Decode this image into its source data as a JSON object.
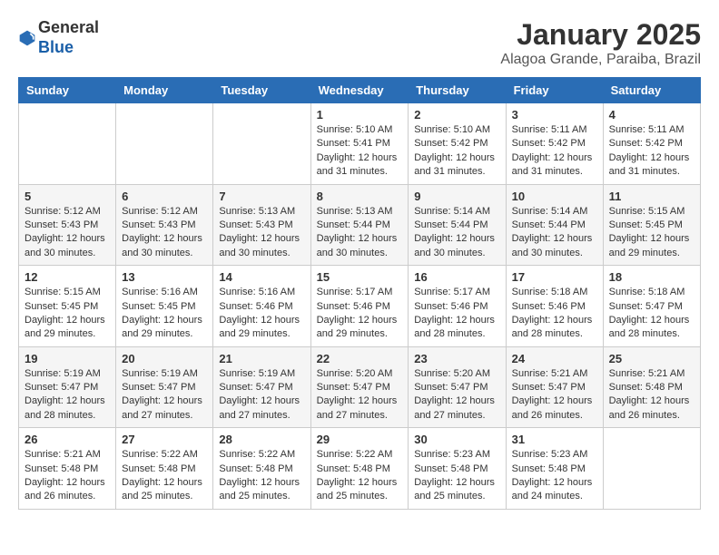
{
  "header": {
    "logo_line1": "General",
    "logo_line2": "Blue",
    "month_title": "January 2025",
    "location": "Alagoa Grande, Paraiba, Brazil"
  },
  "weekdays": [
    "Sunday",
    "Monday",
    "Tuesday",
    "Wednesday",
    "Thursday",
    "Friday",
    "Saturday"
  ],
  "weeks": [
    [
      {
        "day": "",
        "info": ""
      },
      {
        "day": "",
        "info": ""
      },
      {
        "day": "",
        "info": ""
      },
      {
        "day": "1",
        "info": "Sunrise: 5:10 AM\nSunset: 5:41 PM\nDaylight: 12 hours\nand 31 minutes."
      },
      {
        "day": "2",
        "info": "Sunrise: 5:10 AM\nSunset: 5:42 PM\nDaylight: 12 hours\nand 31 minutes."
      },
      {
        "day": "3",
        "info": "Sunrise: 5:11 AM\nSunset: 5:42 PM\nDaylight: 12 hours\nand 31 minutes."
      },
      {
        "day": "4",
        "info": "Sunrise: 5:11 AM\nSunset: 5:42 PM\nDaylight: 12 hours\nand 31 minutes."
      }
    ],
    [
      {
        "day": "5",
        "info": "Sunrise: 5:12 AM\nSunset: 5:43 PM\nDaylight: 12 hours\nand 30 minutes."
      },
      {
        "day": "6",
        "info": "Sunrise: 5:12 AM\nSunset: 5:43 PM\nDaylight: 12 hours\nand 30 minutes."
      },
      {
        "day": "7",
        "info": "Sunrise: 5:13 AM\nSunset: 5:43 PM\nDaylight: 12 hours\nand 30 minutes."
      },
      {
        "day": "8",
        "info": "Sunrise: 5:13 AM\nSunset: 5:44 PM\nDaylight: 12 hours\nand 30 minutes."
      },
      {
        "day": "9",
        "info": "Sunrise: 5:14 AM\nSunset: 5:44 PM\nDaylight: 12 hours\nand 30 minutes."
      },
      {
        "day": "10",
        "info": "Sunrise: 5:14 AM\nSunset: 5:44 PM\nDaylight: 12 hours\nand 30 minutes."
      },
      {
        "day": "11",
        "info": "Sunrise: 5:15 AM\nSunset: 5:45 PM\nDaylight: 12 hours\nand 29 minutes."
      }
    ],
    [
      {
        "day": "12",
        "info": "Sunrise: 5:15 AM\nSunset: 5:45 PM\nDaylight: 12 hours\nand 29 minutes."
      },
      {
        "day": "13",
        "info": "Sunrise: 5:16 AM\nSunset: 5:45 PM\nDaylight: 12 hours\nand 29 minutes."
      },
      {
        "day": "14",
        "info": "Sunrise: 5:16 AM\nSunset: 5:46 PM\nDaylight: 12 hours\nand 29 minutes."
      },
      {
        "day": "15",
        "info": "Sunrise: 5:17 AM\nSunset: 5:46 PM\nDaylight: 12 hours\nand 29 minutes."
      },
      {
        "day": "16",
        "info": "Sunrise: 5:17 AM\nSunset: 5:46 PM\nDaylight: 12 hours\nand 28 minutes."
      },
      {
        "day": "17",
        "info": "Sunrise: 5:18 AM\nSunset: 5:46 PM\nDaylight: 12 hours\nand 28 minutes."
      },
      {
        "day": "18",
        "info": "Sunrise: 5:18 AM\nSunset: 5:47 PM\nDaylight: 12 hours\nand 28 minutes."
      }
    ],
    [
      {
        "day": "19",
        "info": "Sunrise: 5:19 AM\nSunset: 5:47 PM\nDaylight: 12 hours\nand 28 minutes."
      },
      {
        "day": "20",
        "info": "Sunrise: 5:19 AM\nSunset: 5:47 PM\nDaylight: 12 hours\nand 27 minutes."
      },
      {
        "day": "21",
        "info": "Sunrise: 5:19 AM\nSunset: 5:47 PM\nDaylight: 12 hours\nand 27 minutes."
      },
      {
        "day": "22",
        "info": "Sunrise: 5:20 AM\nSunset: 5:47 PM\nDaylight: 12 hours\nand 27 minutes."
      },
      {
        "day": "23",
        "info": "Sunrise: 5:20 AM\nSunset: 5:47 PM\nDaylight: 12 hours\nand 27 minutes."
      },
      {
        "day": "24",
        "info": "Sunrise: 5:21 AM\nSunset: 5:47 PM\nDaylight: 12 hours\nand 26 minutes."
      },
      {
        "day": "25",
        "info": "Sunrise: 5:21 AM\nSunset: 5:48 PM\nDaylight: 12 hours\nand 26 minutes."
      }
    ],
    [
      {
        "day": "26",
        "info": "Sunrise: 5:21 AM\nSunset: 5:48 PM\nDaylight: 12 hours\nand 26 minutes."
      },
      {
        "day": "27",
        "info": "Sunrise: 5:22 AM\nSunset: 5:48 PM\nDaylight: 12 hours\nand 25 minutes."
      },
      {
        "day": "28",
        "info": "Sunrise: 5:22 AM\nSunset: 5:48 PM\nDaylight: 12 hours\nand 25 minutes."
      },
      {
        "day": "29",
        "info": "Sunrise: 5:22 AM\nSunset: 5:48 PM\nDaylight: 12 hours\nand 25 minutes."
      },
      {
        "day": "30",
        "info": "Sunrise: 5:23 AM\nSunset: 5:48 PM\nDaylight: 12 hours\nand 25 minutes."
      },
      {
        "day": "31",
        "info": "Sunrise: 5:23 AM\nSunset: 5:48 PM\nDaylight: 12 hours\nand 24 minutes."
      },
      {
        "day": "",
        "info": ""
      }
    ]
  ]
}
